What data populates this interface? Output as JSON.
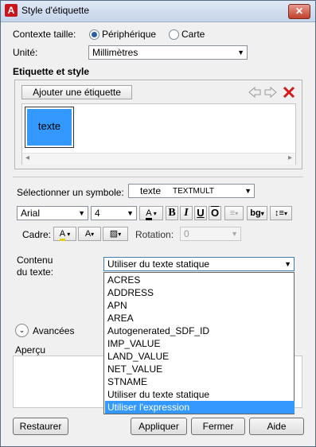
{
  "window": {
    "title": "Style d'étiquette",
    "app_icon": "A",
    "close_label": "✕"
  },
  "context": {
    "label": "Contexte taille:",
    "option1": "Périphérique",
    "option2": "Carte",
    "selected": "Périphérique"
  },
  "unit": {
    "label": "Unité:",
    "value": "Millimètres"
  },
  "section": {
    "title": "Etiquette et style"
  },
  "tabs": {
    "add_label": "Ajouter une étiquette"
  },
  "preview_tile": {
    "text": "texte",
    "color": "#3399ff"
  },
  "scroll": {
    "left": "◂",
    "right": "▸"
  },
  "symbol": {
    "label": "Sélectionner un symbole:",
    "sample": "texte",
    "value": "TEXTMULT"
  },
  "font": {
    "family": "Arial",
    "size": "4",
    "color_glyph": "A",
    "bold": "B",
    "italic": "I",
    "underline": "U",
    "overline": "O",
    "bg": "bg"
  },
  "frame": {
    "label": "Cadre:",
    "glyph_a": "A",
    "glyph_b": "A",
    "rotation_label": "Rotation:",
    "rotation_value": "0"
  },
  "content": {
    "label_line1": "Contenu",
    "label_line2": "du texte:",
    "selected": "Utiliser du texte statique"
  },
  "dropdown": {
    "items": [
      "ACRES",
      "ADDRESS",
      "APN",
      "AREA",
      "Autogenerated_SDF_ID",
      "IMP_VALUE",
      "LAND_VALUE",
      "NET_VALUE",
      "STNAME",
      "Utiliser du texte statique",
      "Utiliser l'expression"
    ],
    "highlighted_index": 10
  },
  "advanced": {
    "label": "Avancées"
  },
  "preview": {
    "label": "Aperçu"
  },
  "buttons": {
    "reset": "Restaurer",
    "apply": "Appliquer",
    "close": "Fermer",
    "help": "Aide"
  },
  "colors": {
    "accent": "#3399ff",
    "selection": "#3399ff",
    "delete": "#d11a1a"
  }
}
